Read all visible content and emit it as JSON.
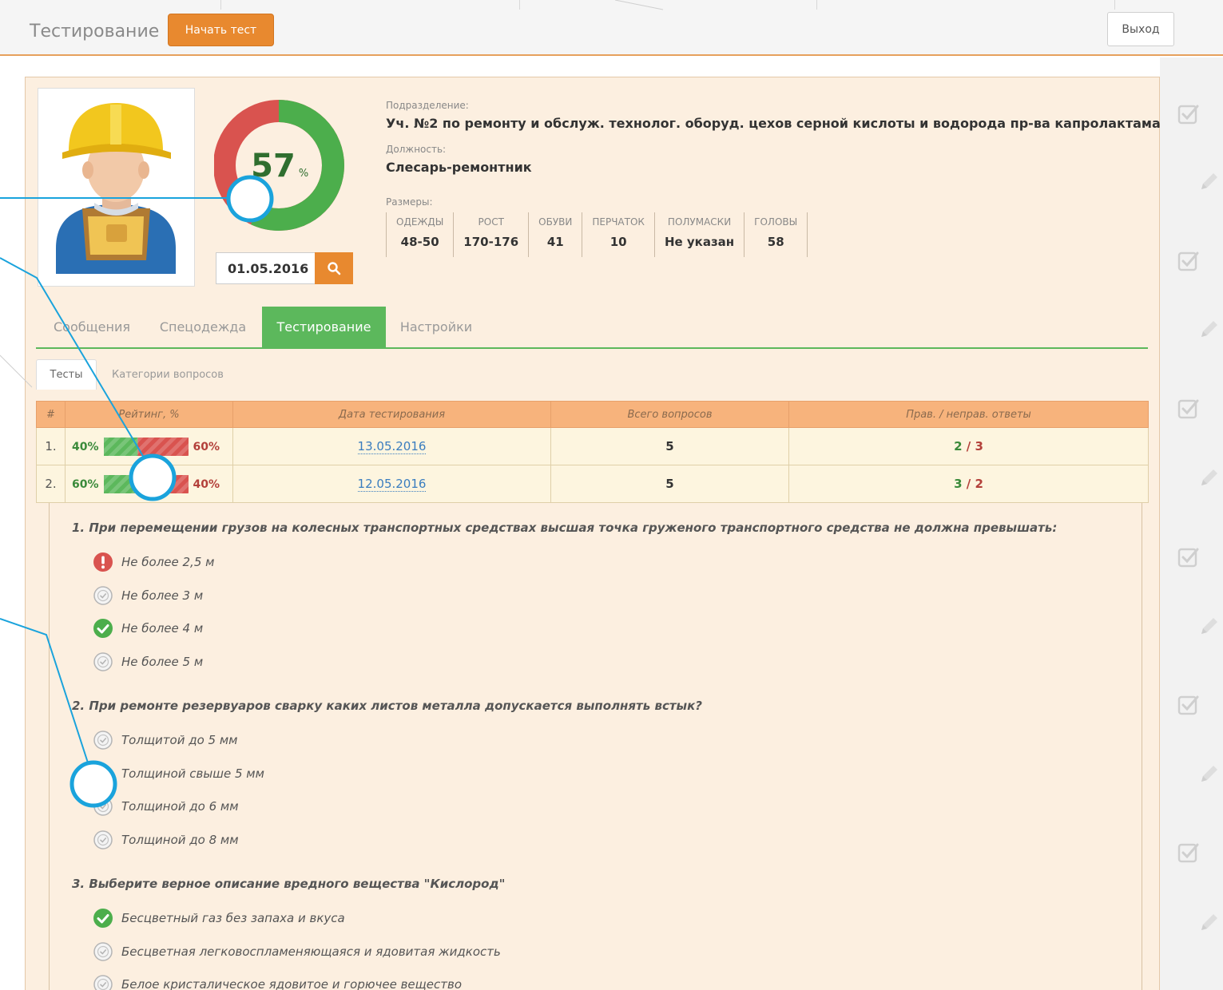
{
  "header": {
    "title": "Тестирование",
    "start_button": "Начать тест",
    "exit_button": "Выход"
  },
  "profile": {
    "score_value": "57",
    "score_unit": "%",
    "score_percent": 57,
    "date": "01.05.2016",
    "department_label": "Подразделение:",
    "department": "Уч. №2 по ремонту и обслуж. технолог. оборуд. цехов серной кислоты и водорода пр-ва капролактама",
    "position_label": "Должность:",
    "position": "Слесарь-ремонтник",
    "sizes_label": "Размеры:",
    "sizes": [
      {
        "label": "ОДЕЖДЫ",
        "value": "48-50"
      },
      {
        "label": "РОСТ",
        "value": "170-176"
      },
      {
        "label": "ОБУВИ",
        "value": "41"
      },
      {
        "label": "ПЕРЧАТОК",
        "value": "10"
      },
      {
        "label": "ПОЛУМАСКИ",
        "value": "Не указан"
      },
      {
        "label": "ГОЛОВЫ",
        "value": "58"
      }
    ]
  },
  "tabs": [
    "Сообщения",
    "Спецодежда",
    "Тестирование",
    "Настройки"
  ],
  "subtabs": [
    "Тесты",
    "Категории вопросов"
  ],
  "table": {
    "headers": [
      "#",
      "Рейтинг, %",
      "Дата тестирования",
      "Всего вопросов",
      "Прав. / неправ. ответы"
    ],
    "rows": [
      {
        "num": "1.",
        "good": "40%",
        "bad": "60%",
        "good_fraction": 0.4,
        "date": "13.05.2016",
        "total": "5",
        "right": "2",
        "sep": " / ",
        "wrong": "3"
      },
      {
        "num": "2.",
        "good": "60%",
        "bad": "40%",
        "good_fraction": 0.6,
        "date": "12.05.2016",
        "total": "5",
        "right": "3",
        "sep": " / ",
        "wrong": "2"
      }
    ]
  },
  "questions": [
    {
      "text": "1.  При перемещении грузов на колесных транспортных средствах высшая точка груженого транспортного средства не должна превышать:",
      "answers": [
        {
          "text": "Не более 2,5 м",
          "state": "wrong"
        },
        {
          "text": "Не более 3 м",
          "state": "neutral"
        },
        {
          "text": "Не более 4 м",
          "state": "correct"
        },
        {
          "text": "Не более 5 м",
          "state": "neutral"
        }
      ]
    },
    {
      "text": "2.  При ремонте резервуаров сварку каких листов металла допускается выполнять встык?",
      "answers": [
        {
          "text": "Толщитой до 5 мм",
          "state": "neutral"
        },
        {
          "text": "Толщиной свыше 5 мм",
          "state": "neutral"
        },
        {
          "text": "Толщиной до 6 мм",
          "state": "neutral"
        },
        {
          "text": "Толщиной до 8 мм",
          "state": "neutral"
        }
      ]
    },
    {
      "text": "3.  Выберите верное описание вредного вещества \"Кислород\"",
      "answers": [
        {
          "text": "Бесцветный газ без запаха и вкуса",
          "state": "correct"
        },
        {
          "text": "Бесцветная легковоспламеняющаяся и ядовитая жидкость",
          "state": "neutral"
        },
        {
          "text": "Белое кристалическое ядовитое и горючее вещество",
          "state": "neutral"
        }
      ]
    }
  ],
  "colors": {
    "accent_orange": "#e8892f",
    "green": "#5cb85c",
    "red": "#d9534f",
    "panel_bg": "#fcefe0",
    "callout_blue": "#1aa3dc"
  },
  "icons": {
    "search": "search-icon",
    "check_square": "checkbox-icon",
    "pencil": "pencil-icon",
    "correct": "check-circle-icon",
    "wrong": "exclamation-circle-icon",
    "neutral": "circle-check-outline-icon"
  }
}
